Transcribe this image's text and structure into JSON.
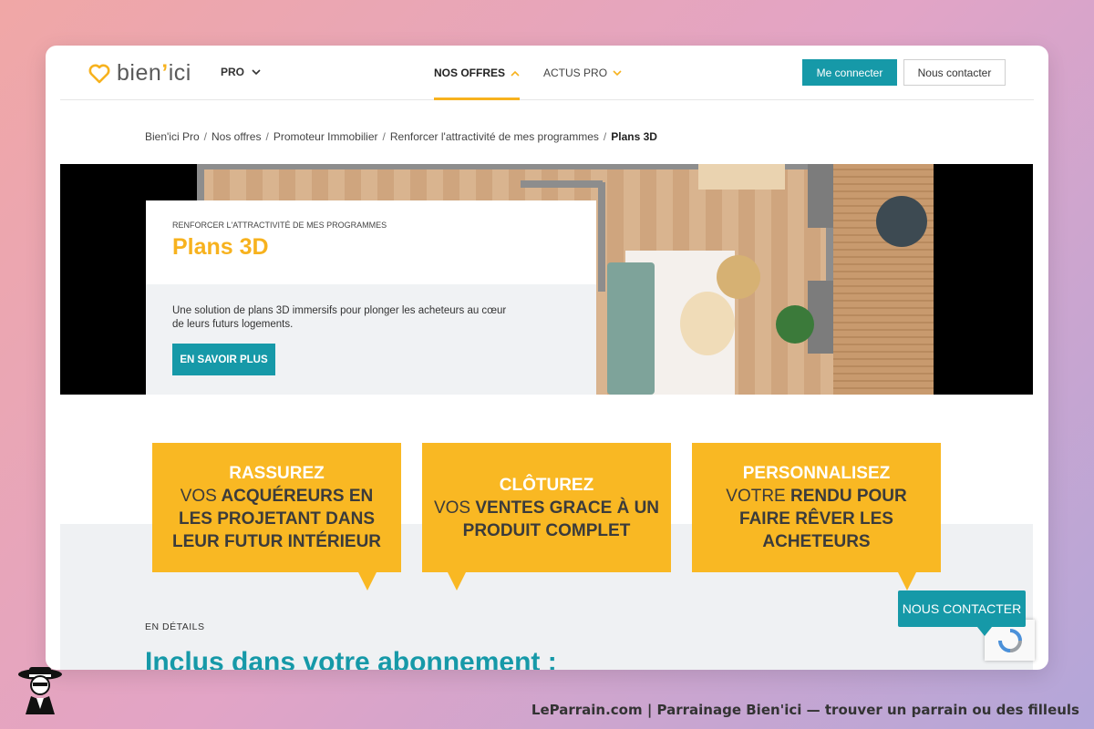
{
  "colors": {
    "brand_yellow": "#f7b21e",
    "brand_teal": "#1699a8",
    "bubble_yellow": "#f9b823"
  },
  "header": {
    "logo_text_a": "bien",
    "logo_text_b": "ici",
    "pro_label": "PRO",
    "nav": [
      {
        "label": "NOS OFFRES",
        "active": true
      },
      {
        "label": "ACTUS PRO",
        "active": false
      }
    ],
    "login_label": "Me connecter",
    "contact_label": "Nous contacter"
  },
  "breadcrumb": [
    "Bien'ici Pro",
    "Nos offres",
    "Promoteur Immobilier",
    "Renforcer l'attractivité de mes programmes",
    "Plans 3D"
  ],
  "hero": {
    "kicker": "RENFORCER L'ATTRACTIVITÉ DE MES PROGRAMMES",
    "title": "Plans 3D",
    "description": "Une solution de plans 3D immersifs pour plonger les acheteurs au cœur de leurs futurs logements.",
    "cta": "EN SAVOIR PLUS"
  },
  "bubbles": [
    {
      "strong": "RASSUREZ",
      "light": "VOS",
      "rest": "ACQUÉREURS EN LES PROJETANT DANS LEUR FUTUR INTÉRIEUR"
    },
    {
      "strong": "CLÔTUREZ",
      "light": "VOS",
      "rest": "VENTES GRACE À UN PRODUIT COMPLET"
    },
    {
      "strong": "PERSONNALISEZ",
      "light": "VOTRE",
      "rest": "RENDU POUR FAIRE RÊVER LES ACHETEURS"
    }
  ],
  "details": {
    "kicker": "EN DÉTAILS",
    "title": "Inclus dans votre abonnement :"
  },
  "floating_contact": "NOUS CONTACTER",
  "footer": "LeParrain.com | Parrainage Bien'ici — trouver un parrain ou des filleuls"
}
